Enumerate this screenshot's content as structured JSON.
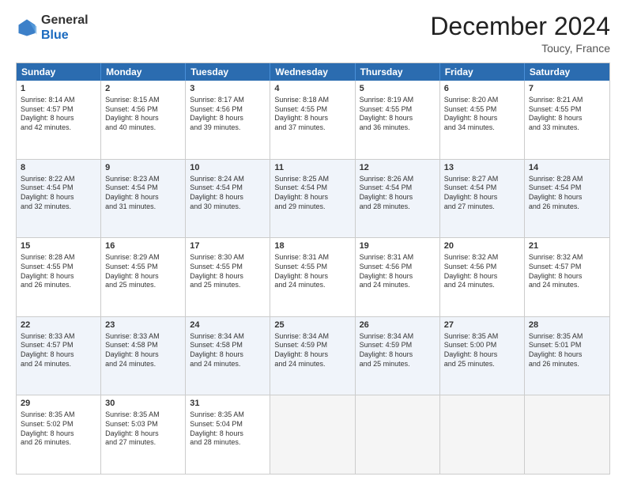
{
  "header": {
    "logo_line1": "General",
    "logo_line2": "Blue",
    "month_title": "December 2024",
    "location": "Toucy, France"
  },
  "days_of_week": [
    "Sunday",
    "Monday",
    "Tuesday",
    "Wednesday",
    "Thursday",
    "Friday",
    "Saturday"
  ],
  "rows": [
    {
      "alt": false,
      "cells": [
        {
          "day": "1",
          "lines": [
            "Sunrise: 8:14 AM",
            "Sunset: 4:57 PM",
            "Daylight: 8 hours",
            "and 42 minutes."
          ]
        },
        {
          "day": "2",
          "lines": [
            "Sunrise: 8:15 AM",
            "Sunset: 4:56 PM",
            "Daylight: 8 hours",
            "and 40 minutes."
          ]
        },
        {
          "day": "3",
          "lines": [
            "Sunrise: 8:17 AM",
            "Sunset: 4:56 PM",
            "Daylight: 8 hours",
            "and 39 minutes."
          ]
        },
        {
          "day": "4",
          "lines": [
            "Sunrise: 8:18 AM",
            "Sunset: 4:55 PM",
            "Daylight: 8 hours",
            "and 37 minutes."
          ]
        },
        {
          "day": "5",
          "lines": [
            "Sunrise: 8:19 AM",
            "Sunset: 4:55 PM",
            "Daylight: 8 hours",
            "and 36 minutes."
          ]
        },
        {
          "day": "6",
          "lines": [
            "Sunrise: 8:20 AM",
            "Sunset: 4:55 PM",
            "Daylight: 8 hours",
            "and 34 minutes."
          ]
        },
        {
          "day": "7",
          "lines": [
            "Sunrise: 8:21 AM",
            "Sunset: 4:55 PM",
            "Daylight: 8 hours",
            "and 33 minutes."
          ]
        }
      ]
    },
    {
      "alt": true,
      "cells": [
        {
          "day": "8",
          "lines": [
            "Sunrise: 8:22 AM",
            "Sunset: 4:54 PM",
            "Daylight: 8 hours",
            "and 32 minutes."
          ]
        },
        {
          "day": "9",
          "lines": [
            "Sunrise: 8:23 AM",
            "Sunset: 4:54 PM",
            "Daylight: 8 hours",
            "and 31 minutes."
          ]
        },
        {
          "day": "10",
          "lines": [
            "Sunrise: 8:24 AM",
            "Sunset: 4:54 PM",
            "Daylight: 8 hours",
            "and 30 minutes."
          ]
        },
        {
          "day": "11",
          "lines": [
            "Sunrise: 8:25 AM",
            "Sunset: 4:54 PM",
            "Daylight: 8 hours",
            "and 29 minutes."
          ]
        },
        {
          "day": "12",
          "lines": [
            "Sunrise: 8:26 AM",
            "Sunset: 4:54 PM",
            "Daylight: 8 hours",
            "and 28 minutes."
          ]
        },
        {
          "day": "13",
          "lines": [
            "Sunrise: 8:27 AM",
            "Sunset: 4:54 PM",
            "Daylight: 8 hours",
            "and 27 minutes."
          ]
        },
        {
          "day": "14",
          "lines": [
            "Sunrise: 8:28 AM",
            "Sunset: 4:54 PM",
            "Daylight: 8 hours",
            "and 26 minutes."
          ]
        }
      ]
    },
    {
      "alt": false,
      "cells": [
        {
          "day": "15",
          "lines": [
            "Sunrise: 8:28 AM",
            "Sunset: 4:55 PM",
            "Daylight: 8 hours",
            "and 26 minutes."
          ]
        },
        {
          "day": "16",
          "lines": [
            "Sunrise: 8:29 AM",
            "Sunset: 4:55 PM",
            "Daylight: 8 hours",
            "and 25 minutes."
          ]
        },
        {
          "day": "17",
          "lines": [
            "Sunrise: 8:30 AM",
            "Sunset: 4:55 PM",
            "Daylight: 8 hours",
            "and 25 minutes."
          ]
        },
        {
          "day": "18",
          "lines": [
            "Sunrise: 8:31 AM",
            "Sunset: 4:55 PM",
            "Daylight: 8 hours",
            "and 24 minutes."
          ]
        },
        {
          "day": "19",
          "lines": [
            "Sunrise: 8:31 AM",
            "Sunset: 4:56 PM",
            "Daylight: 8 hours",
            "and 24 minutes."
          ]
        },
        {
          "day": "20",
          "lines": [
            "Sunrise: 8:32 AM",
            "Sunset: 4:56 PM",
            "Daylight: 8 hours",
            "and 24 minutes."
          ]
        },
        {
          "day": "21",
          "lines": [
            "Sunrise: 8:32 AM",
            "Sunset: 4:57 PM",
            "Daylight: 8 hours",
            "and 24 minutes."
          ]
        }
      ]
    },
    {
      "alt": true,
      "cells": [
        {
          "day": "22",
          "lines": [
            "Sunrise: 8:33 AM",
            "Sunset: 4:57 PM",
            "Daylight: 8 hours",
            "and 24 minutes."
          ]
        },
        {
          "day": "23",
          "lines": [
            "Sunrise: 8:33 AM",
            "Sunset: 4:58 PM",
            "Daylight: 8 hours",
            "and 24 minutes."
          ]
        },
        {
          "day": "24",
          "lines": [
            "Sunrise: 8:34 AM",
            "Sunset: 4:58 PM",
            "Daylight: 8 hours",
            "and 24 minutes."
          ]
        },
        {
          "day": "25",
          "lines": [
            "Sunrise: 8:34 AM",
            "Sunset: 4:59 PM",
            "Daylight: 8 hours",
            "and 24 minutes."
          ]
        },
        {
          "day": "26",
          "lines": [
            "Sunrise: 8:34 AM",
            "Sunset: 4:59 PM",
            "Daylight: 8 hours",
            "and 25 minutes."
          ]
        },
        {
          "day": "27",
          "lines": [
            "Sunrise: 8:35 AM",
            "Sunset: 5:00 PM",
            "Daylight: 8 hours",
            "and 25 minutes."
          ]
        },
        {
          "day": "28",
          "lines": [
            "Sunrise: 8:35 AM",
            "Sunset: 5:01 PM",
            "Daylight: 8 hours",
            "and 26 minutes."
          ]
        }
      ]
    },
    {
      "alt": false,
      "cells": [
        {
          "day": "29",
          "lines": [
            "Sunrise: 8:35 AM",
            "Sunset: 5:02 PM",
            "Daylight: 8 hours",
            "and 26 minutes."
          ]
        },
        {
          "day": "30",
          "lines": [
            "Sunrise: 8:35 AM",
            "Sunset: 5:03 PM",
            "Daylight: 8 hours",
            "and 27 minutes."
          ]
        },
        {
          "day": "31",
          "lines": [
            "Sunrise: 8:35 AM",
            "Sunset: 5:04 PM",
            "Daylight: 8 hours",
            "and 28 minutes."
          ]
        },
        {
          "day": "",
          "lines": []
        },
        {
          "day": "",
          "lines": []
        },
        {
          "day": "",
          "lines": []
        },
        {
          "day": "",
          "lines": []
        }
      ]
    }
  ]
}
